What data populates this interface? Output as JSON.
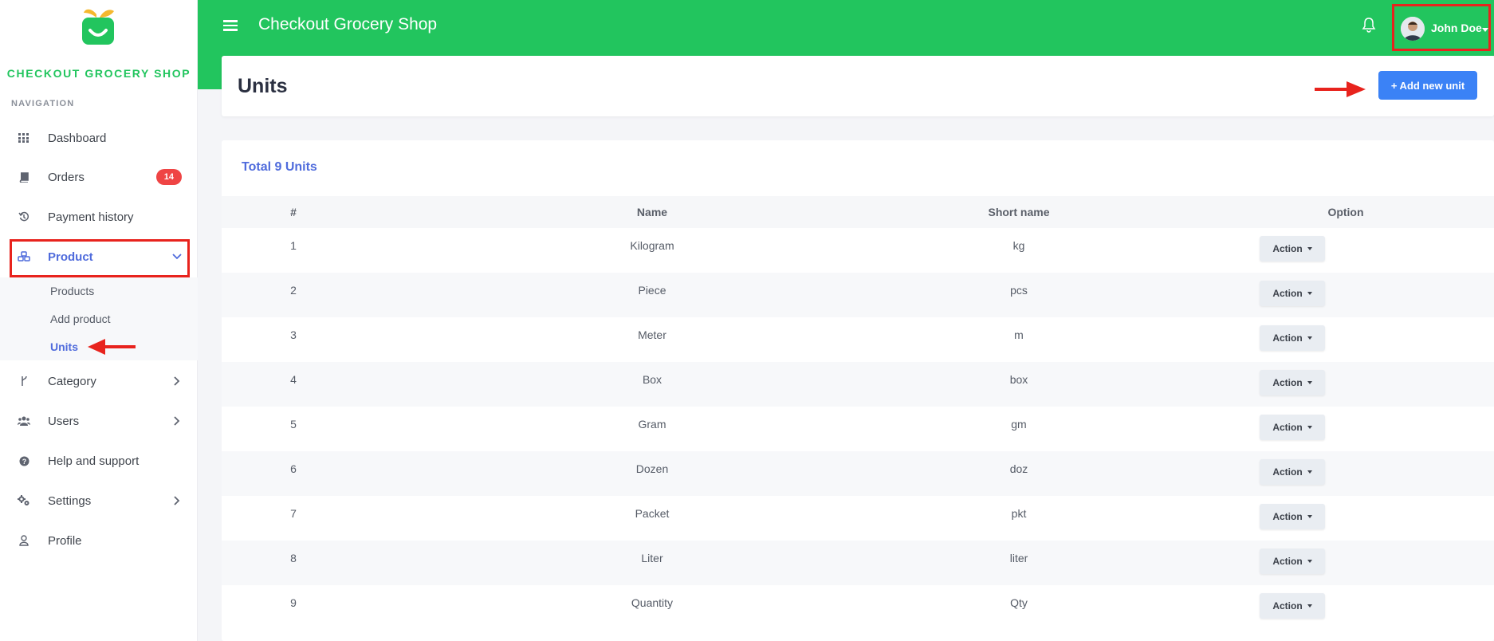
{
  "app": {
    "brand": "CHECKOUT GROCERY SHOP",
    "title": "Checkout Grocery Shop"
  },
  "sidebar": {
    "caption": "NAVIGATION",
    "items": [
      {
        "label": "Dashboard",
        "icon": "grid-icon"
      },
      {
        "label": "Orders",
        "icon": "book-icon",
        "badge": "14"
      },
      {
        "label": "Payment history",
        "icon": "history-icon"
      },
      {
        "label": "Product",
        "icon": "cubes-icon"
      },
      {
        "label": "Category",
        "icon": "code-branch-icon"
      },
      {
        "label": "Users",
        "icon": "users-icon"
      },
      {
        "label": "Help and support",
        "icon": "question-circle-icon"
      },
      {
        "label": "Settings",
        "icon": "cogs-icon"
      },
      {
        "label": "Profile",
        "icon": "user-icon"
      }
    ],
    "product_sub": [
      "Products",
      "Add product",
      "Units"
    ]
  },
  "topbar": {
    "user_name": "John Doe"
  },
  "header": {
    "title": "Units",
    "add_button": "+ Add new unit"
  },
  "table": {
    "total_label": "Total 9 Units",
    "columns": [
      "#",
      "Name",
      "Short name",
      "Option"
    ],
    "rows": [
      {
        "num": "1",
        "name": "Kilogram",
        "short": "kg",
        "action": "Action"
      },
      {
        "num": "2",
        "name": "Piece",
        "short": "pcs",
        "action": "Action"
      },
      {
        "num": "3",
        "name": "Meter",
        "short": "m",
        "action": "Action"
      },
      {
        "num": "4",
        "name": "Box",
        "short": "box",
        "action": "Action"
      },
      {
        "num": "5",
        "name": "Gram",
        "short": "gm",
        "action": "Action"
      },
      {
        "num": "6",
        "name": "Dozen",
        "short": "doz",
        "action": "Action"
      },
      {
        "num": "7",
        "name": "Packet",
        "short": "pkt",
        "action": "Action"
      },
      {
        "num": "8",
        "name": "Liter",
        "short": "liter",
        "action": "Action"
      },
      {
        "num": "9",
        "name": "Quantity",
        "short": "Qty",
        "action": "Action"
      }
    ]
  },
  "colors": {
    "primary_green": "#22c55e",
    "accent_blue": "#3b82f6",
    "highlight_red": "#e8231d",
    "active_nav": "#4f6bdc"
  }
}
